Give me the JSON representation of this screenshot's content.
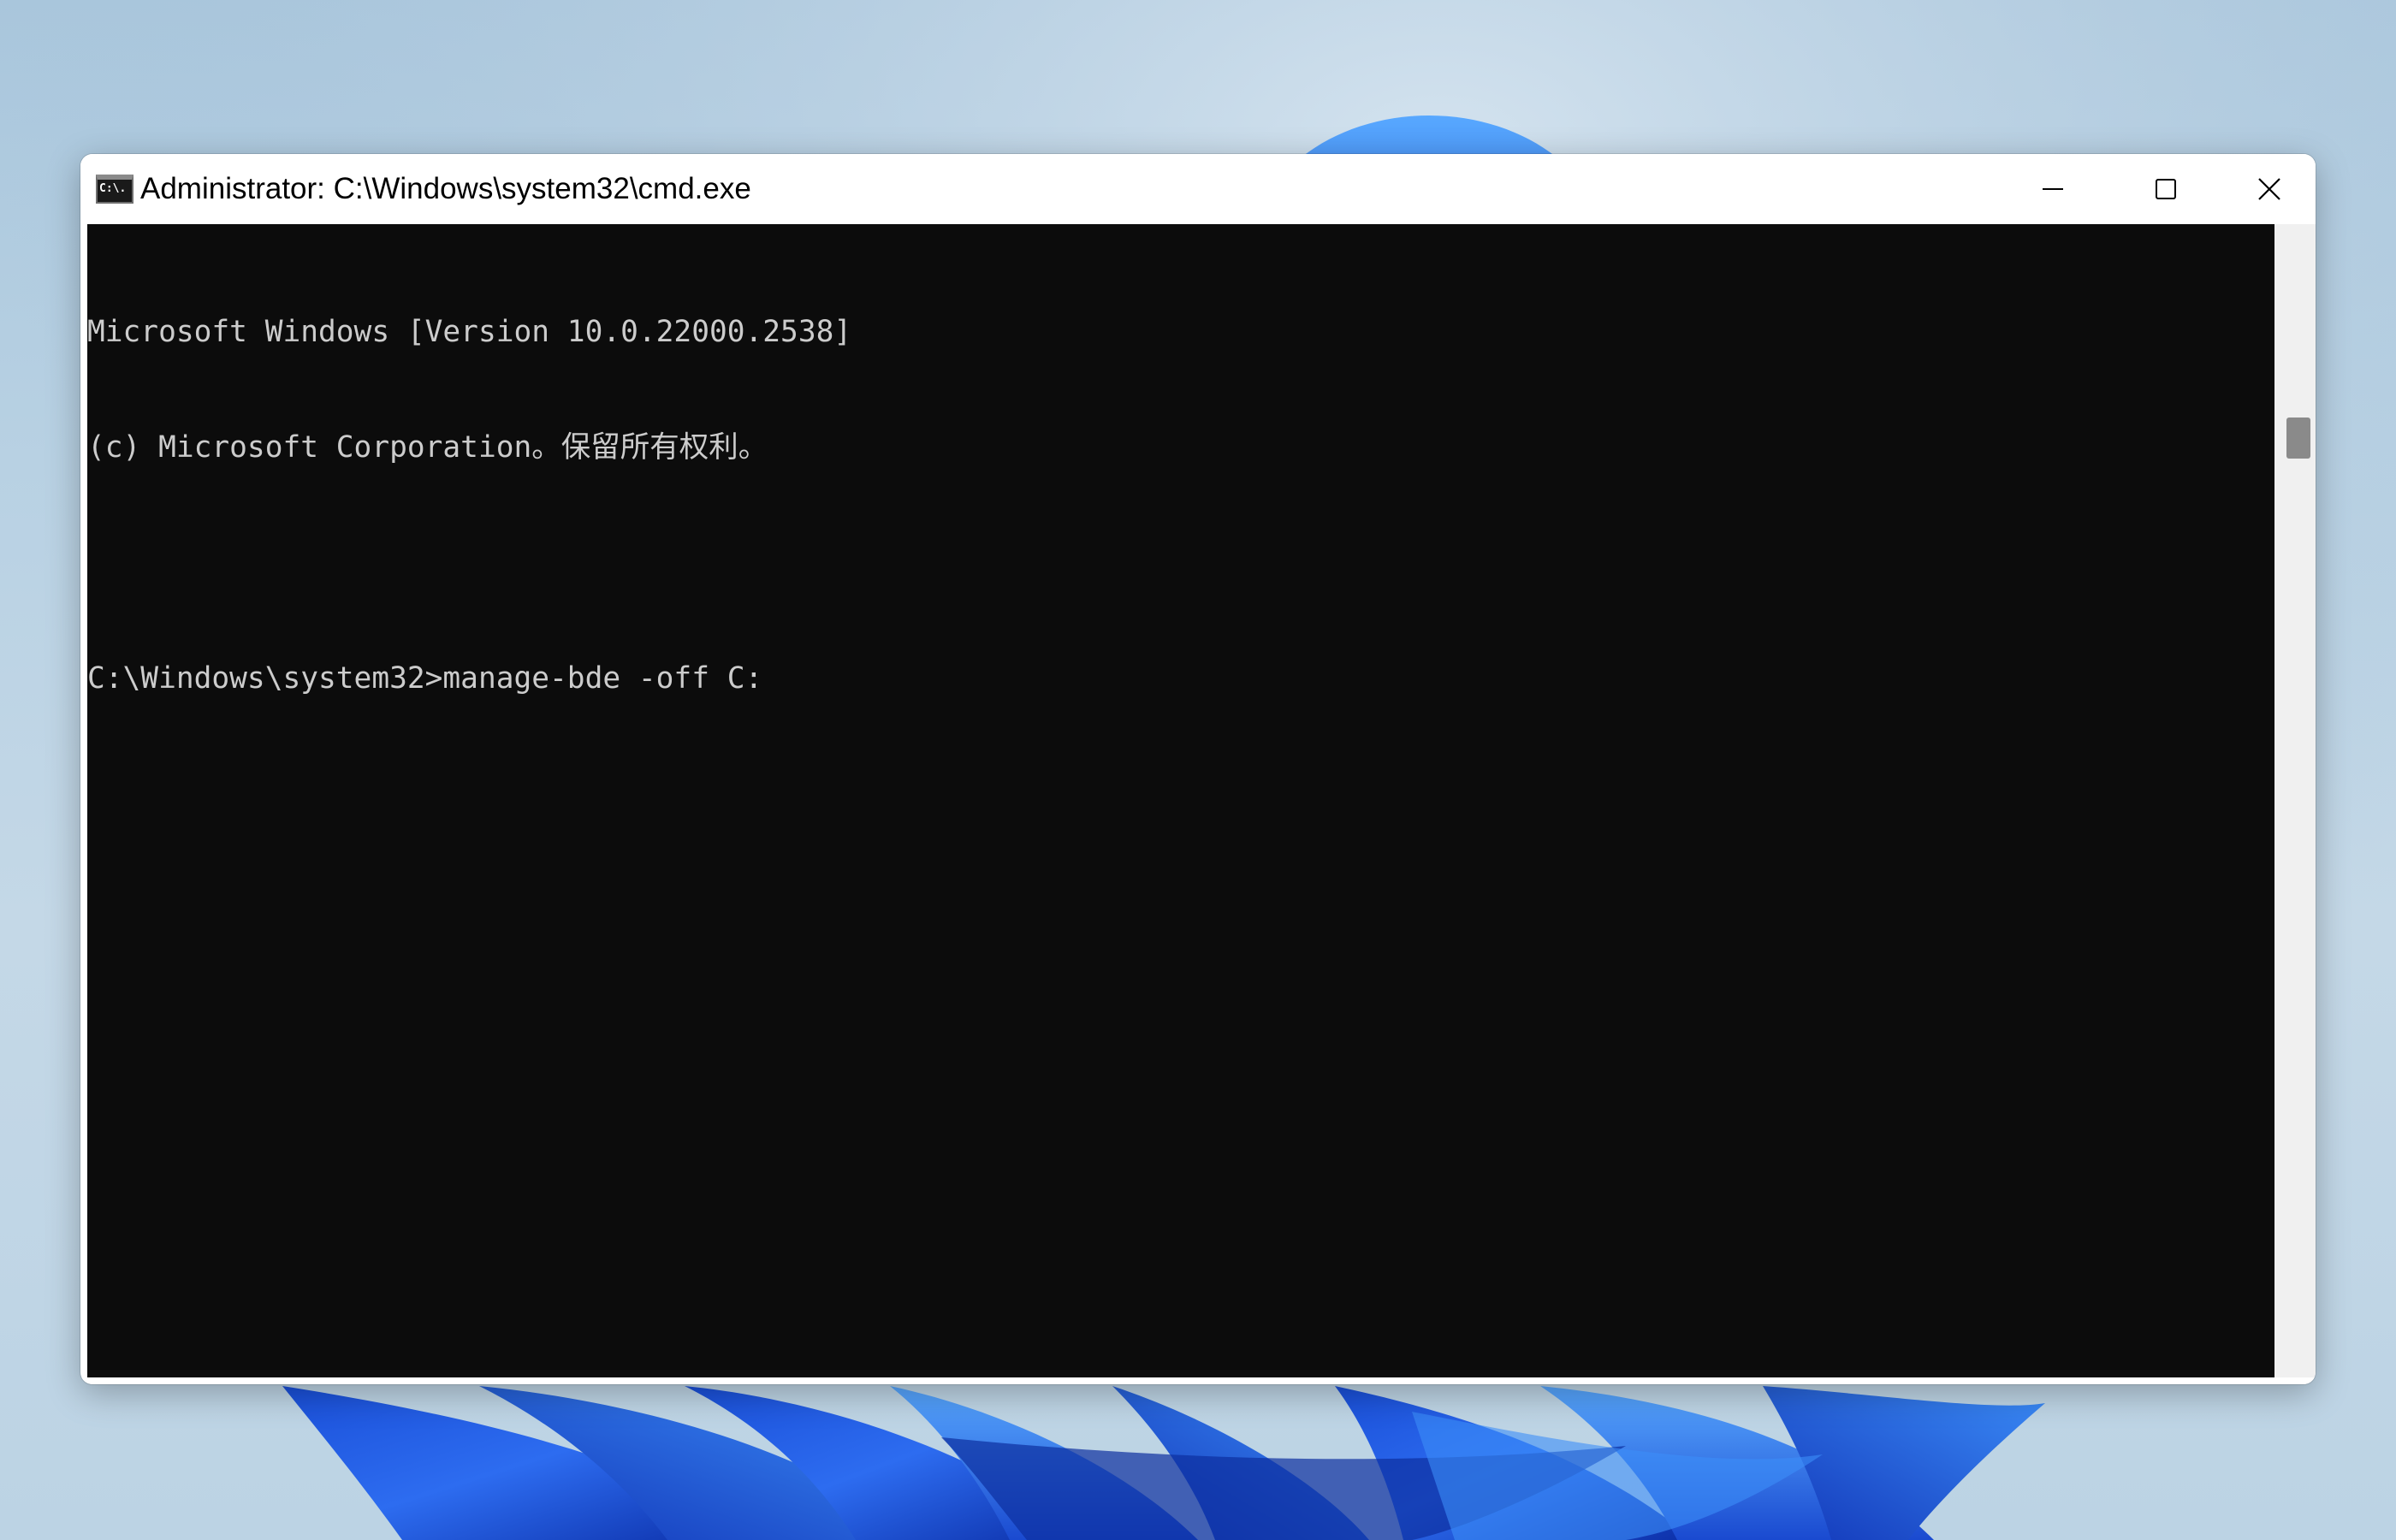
{
  "window": {
    "title": "Administrator: C:\\Windows\\system32\\cmd.exe",
    "app_icon_text": "C:\\."
  },
  "console": {
    "lines": [
      "Microsoft Windows [Version 10.0.22000.2538]",
      "(c) Microsoft Corporation。保留所有权利。",
      "",
      "C:\\Windows\\system32>manage-bde -off C:"
    ]
  },
  "icons": {
    "minimize": "minimize-icon",
    "maximize": "maximize-icon",
    "close": "close-icon",
    "app": "cmd-app-icon"
  },
  "colors": {
    "console_background": "#0c0c0c",
    "console_text": "#cccccc",
    "titlebar_background": "#ffffff",
    "wallpaper_accent": "#1f5fe6"
  }
}
